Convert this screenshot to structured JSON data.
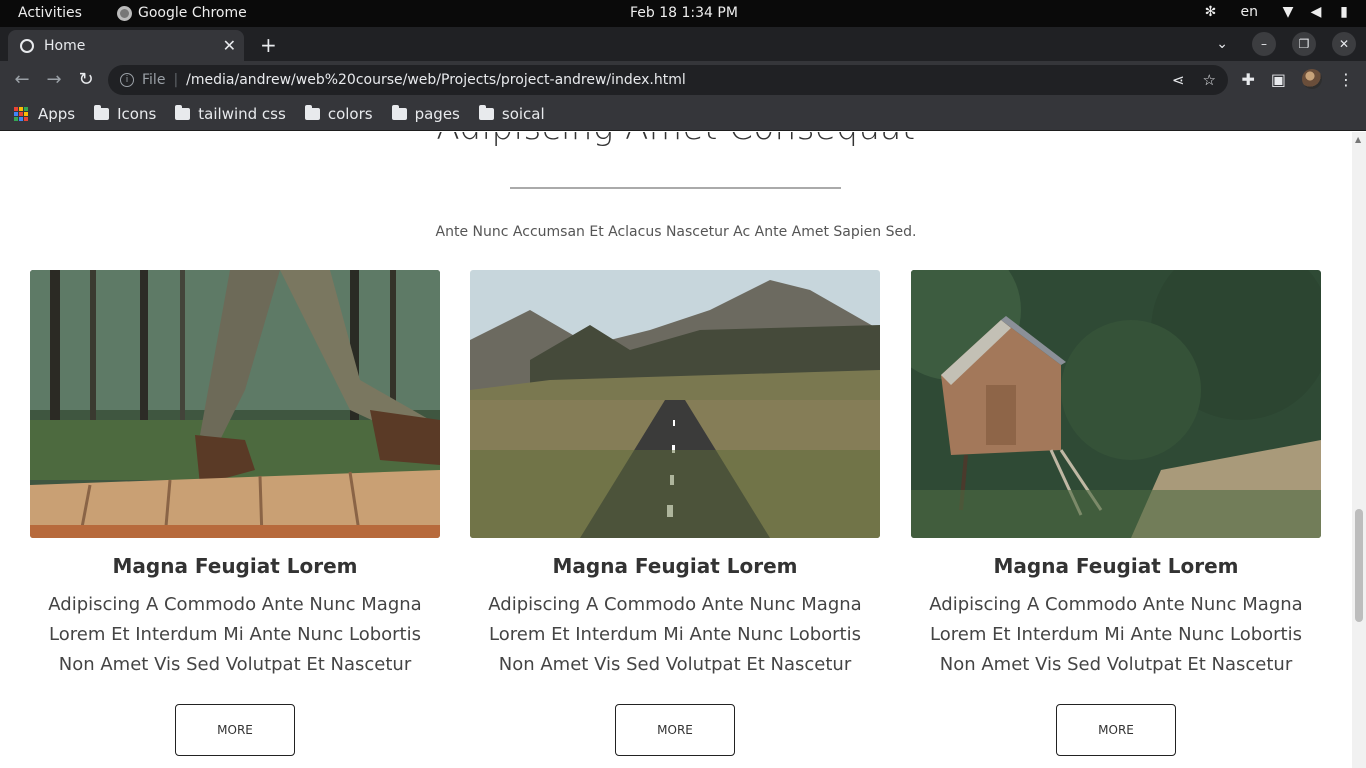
{
  "system": {
    "activities": "Activities",
    "app_name": "Google Chrome",
    "clock": "Feb 18  1:34 PM",
    "language": "en"
  },
  "browser": {
    "tab_title": "Home",
    "url_scheme": "File",
    "url": "/media/andrew/web%20course/web/Projects/project-andrew/index.html",
    "bookmarks": [
      "Apps",
      "Icons",
      "tailwind css",
      "colors",
      "pages",
      "soical"
    ]
  },
  "page": {
    "section_title": "Adipiscing Amet Consequat",
    "subtitle": "Ante Nunc Accumsan Et Aclacus Nascetur Ac Ante Amet Sapien Sed.",
    "cards": [
      {
        "title": "Magna Feugiat Lorem",
        "description": "Adipiscing A Commodo Ante Nunc Magna Lorem Et Interdum Mi Ante Nunc Lobortis Non Amet Vis Sed Volutpat Et Nascetur",
        "button": "MORE"
      },
      {
        "title": "Magna Feugiat Lorem",
        "description": "Adipiscing A Commodo Ante Nunc Magna Lorem Et Interdum Mi Ante Nunc Lobortis Non Amet Vis Sed Volutpat Et Nascetur",
        "button": "MORE"
      },
      {
        "title": "Magna Feugiat Lorem",
        "description": "Adipiscing A Commodo Ante Nunc Magna Lorem Et Interdum Mi Ante Nunc Lobortis Non Amet Vis Sed Volutpat Et Nascetur",
        "button": "MORE"
      }
    ]
  },
  "colors": {
    "system_bar": "#0a0a0a",
    "chrome_dark": "#35363a",
    "tabstrip": "#202124"
  }
}
